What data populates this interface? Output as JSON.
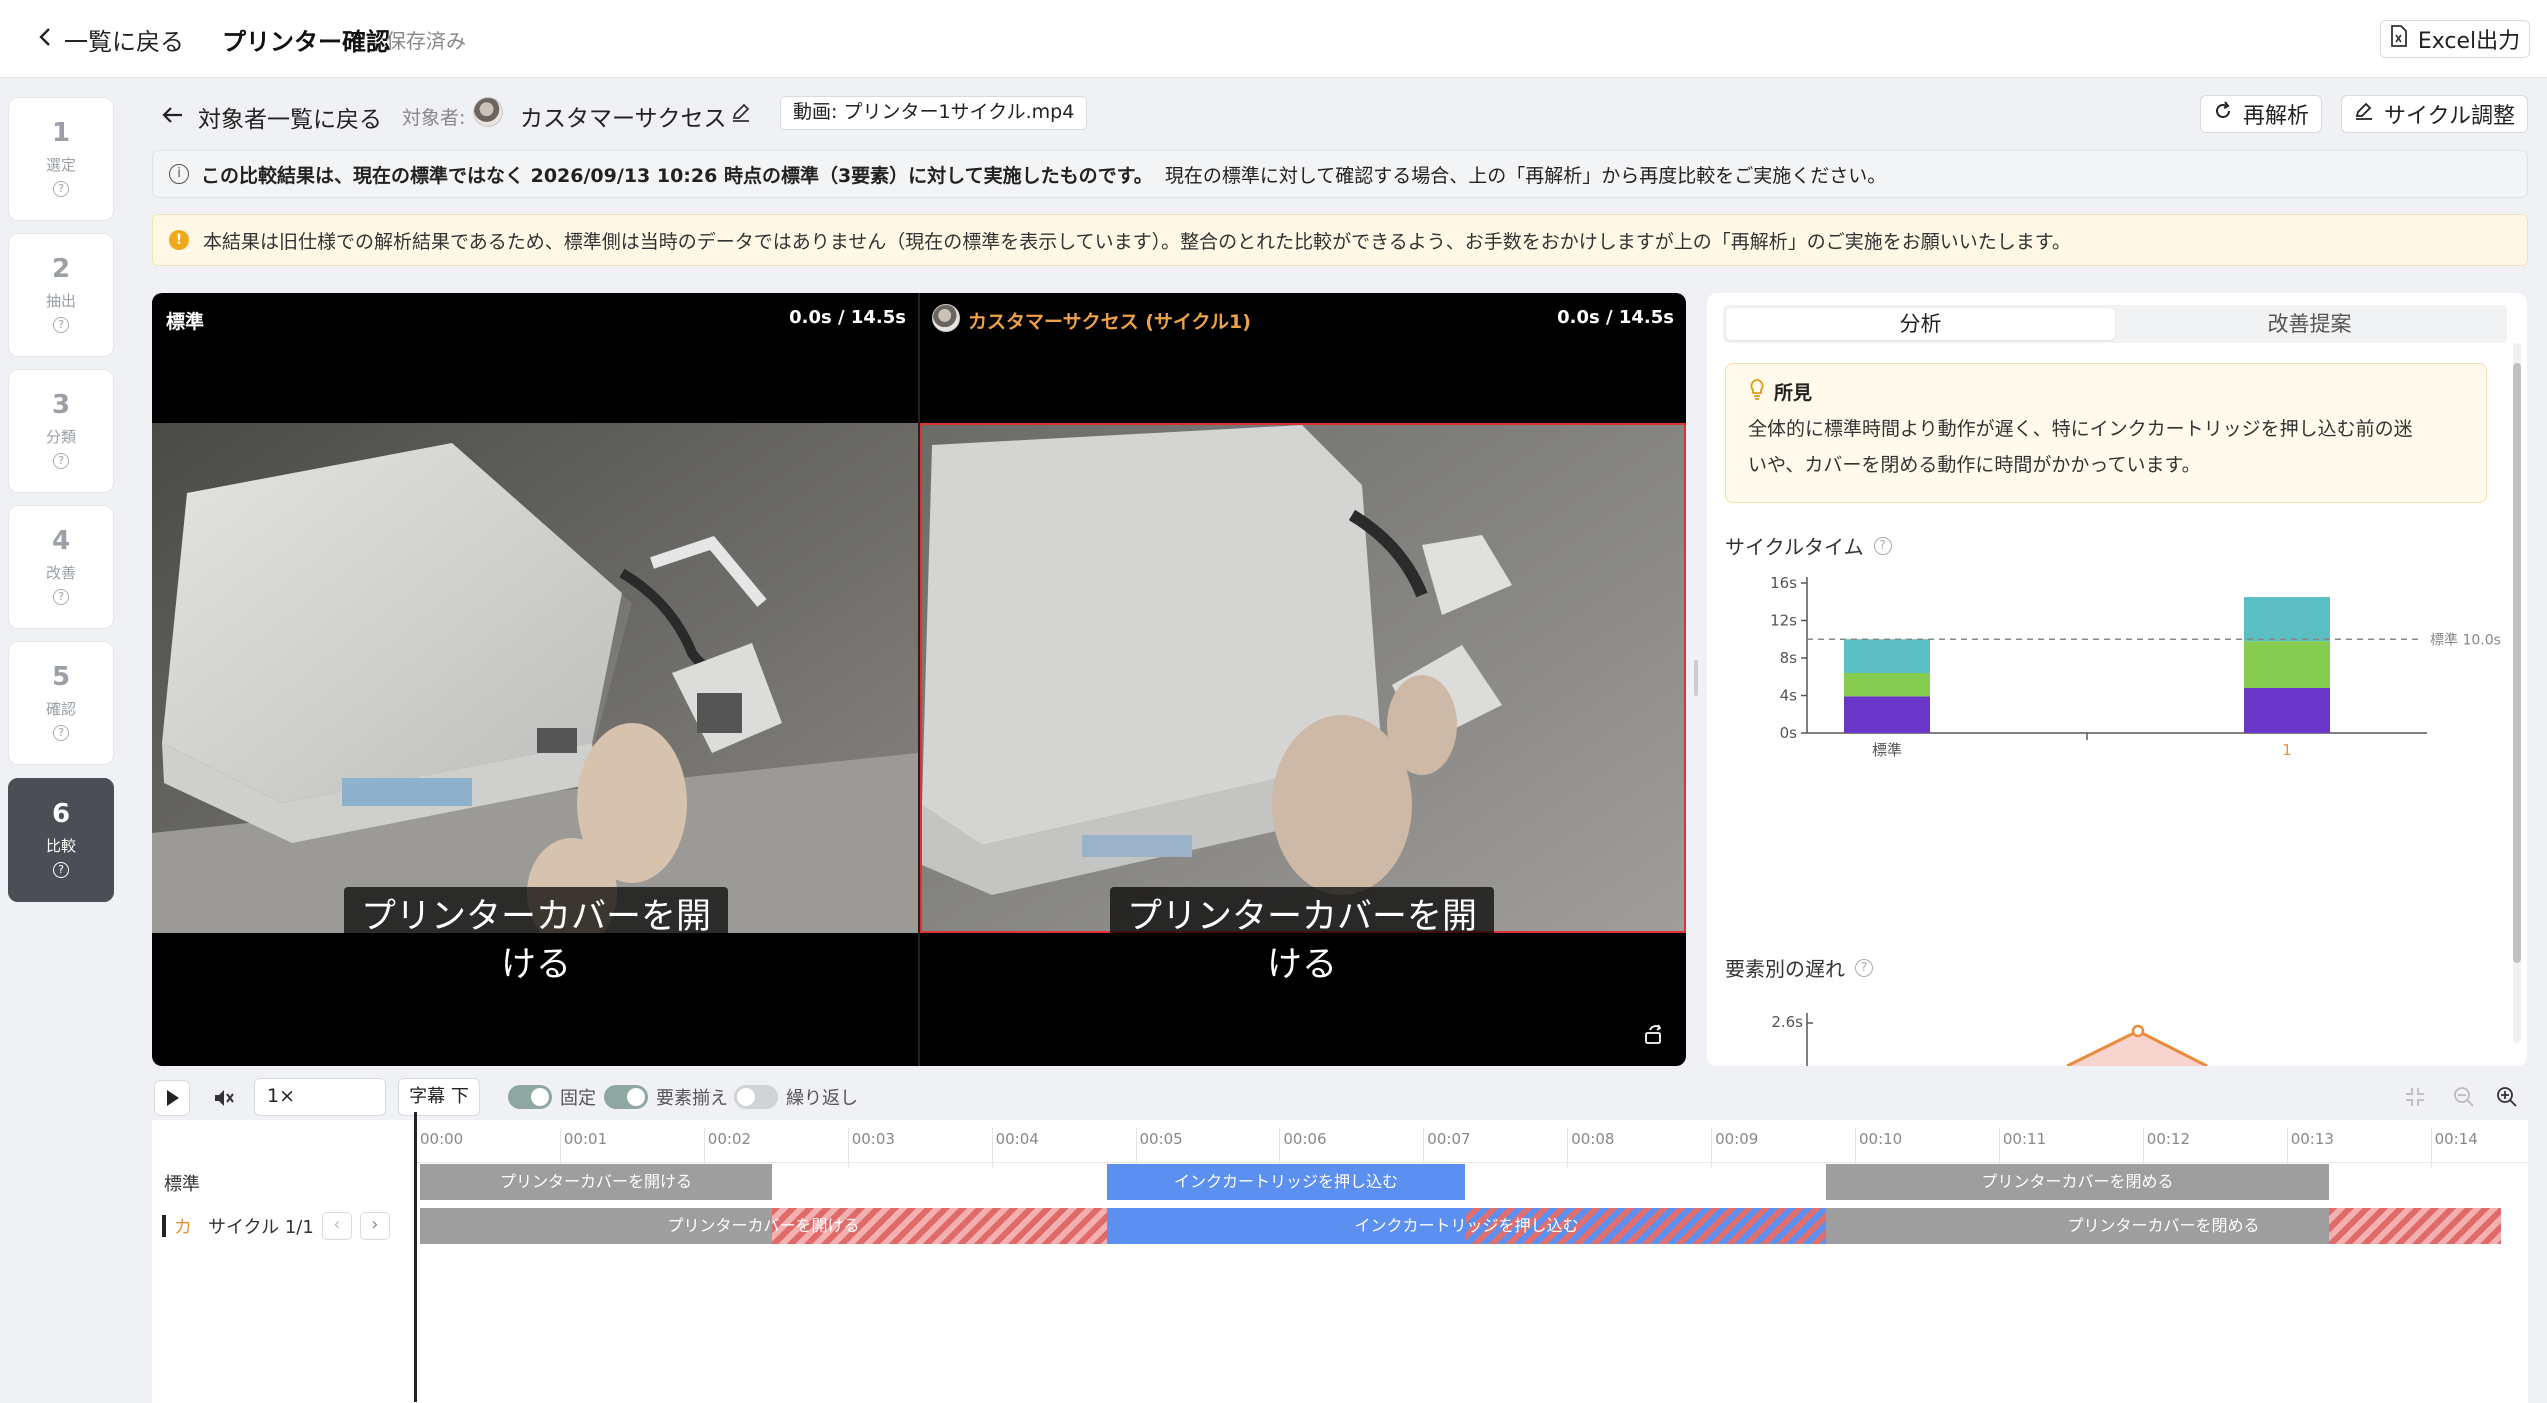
{
  "header": {
    "back_label": "一覧に戻る",
    "title": "プリンター確認",
    "saved": "保存済み",
    "excel_label": "Excel出力"
  },
  "steps": [
    {
      "num": "1",
      "label": "選定",
      "active": false
    },
    {
      "num": "2",
      "label": "抽出",
      "active": false
    },
    {
      "num": "3",
      "label": "分類",
      "active": false
    },
    {
      "num": "4",
      "label": "改善",
      "active": false
    },
    {
      "num": "5",
      "label": "確認",
      "active": false
    },
    {
      "num": "6",
      "label": "比較",
      "active": true
    }
  ],
  "subheader": {
    "back_label": "対象者一覧に戻る",
    "subject_prefix": "対象者:",
    "subject_name": "カスタマーサクセス",
    "video_tag": "動画: プリンター1サイクル.mp4",
    "reanalyze_label": "再解析",
    "cycle_adjust_label": "サイクル調整"
  },
  "banners": {
    "info_bold": "この比較結果は、現在の標準ではなく 2026/09/13 10:26 時点の標準（3要素）に対して実施したものです。",
    "info_rest": "現在の標準に対して確認する場合、上の「再解析」から再度比較をご実施ください。",
    "warn": "本結果は旧仕様での解析結果であるため、標準側は当時のデータではありません（現在の標準を表示しています）。整合のとれた比較ができるよう、お手数をおかけしますが上の「再解析」のご実施をお願いいたします。"
  },
  "video": {
    "left_label": "標準",
    "left_time": "0.0s / 14.5s",
    "right_label": "カスタマーサクセス (サイクル1)",
    "right_time": "0.0s / 14.5s",
    "subtitle_left_1": "プリンターカバーを開",
    "subtitle_left_2": "ける",
    "subtitle_right_1": "プリンターカバーを開",
    "subtitle_right_2": "ける"
  },
  "panel": {
    "tab_analysis": "分析",
    "tab_improve": "改善提案",
    "finding_title": "所見",
    "finding_text_1": "全体的に標準時間より動作が遅く、特にインクカートリッジを押し込む前の迷",
    "finding_text_2": "いや、カバーを閉める動作に時間がかかっています。",
    "cycle_title": "サイクルタイム",
    "delay_title": "要素別の遅れ",
    "delay_ytick": "2.6s"
  },
  "chart_data": {
    "type": "bar",
    "stacked": true,
    "categories": [
      "標準",
      "1"
    ],
    "series": [
      {
        "color": "#6a35c9",
        "values": [
          3.9,
          4.8
        ]
      },
      {
        "color": "#86cc50",
        "values": [
          2.5,
          5.0
        ]
      },
      {
        "color": "#5bbec2",
        "values": [
          3.6,
          4.7
        ]
      }
    ],
    "yticks": [
      "0s",
      "4s",
      "8s",
      "12s",
      "16s"
    ],
    "ylim": [
      0,
      16
    ],
    "reference_line": {
      "value": 10.0,
      "label": "標準 10.0s"
    },
    "highlight_category_color": "#e8923a"
  },
  "controls": {
    "speed": "1×",
    "subtitle_btn": "字幕 下",
    "toggle_fixed": "固定",
    "toggle_align": "要素揃え",
    "toggle_loop": "繰り返し"
  },
  "timeline": {
    "ticks": [
      "00:00",
      "00:01",
      "00:02",
      "00:03",
      "00:04",
      "00:05",
      "00:06",
      "00:07",
      "00:08",
      "00:09",
      "00:10",
      "00:11",
      "00:12",
      "00:13",
      "00:14"
    ],
    "row_standard": "標準",
    "row_subject_icon": "カ",
    "row_cycle": "サイクル 1/1",
    "std_seg1": "プリンターカバーを開ける",
    "std_seg2": "インクカートリッジを押し込む",
    "std_seg3": "プリンターカバーを閉める",
    "cyc_seg1": "プリンターカバーを開ける",
    "cyc_seg2": "インクカートリッジを押し込む",
    "cyc_seg3": "プリンターカバーを閉める"
  }
}
